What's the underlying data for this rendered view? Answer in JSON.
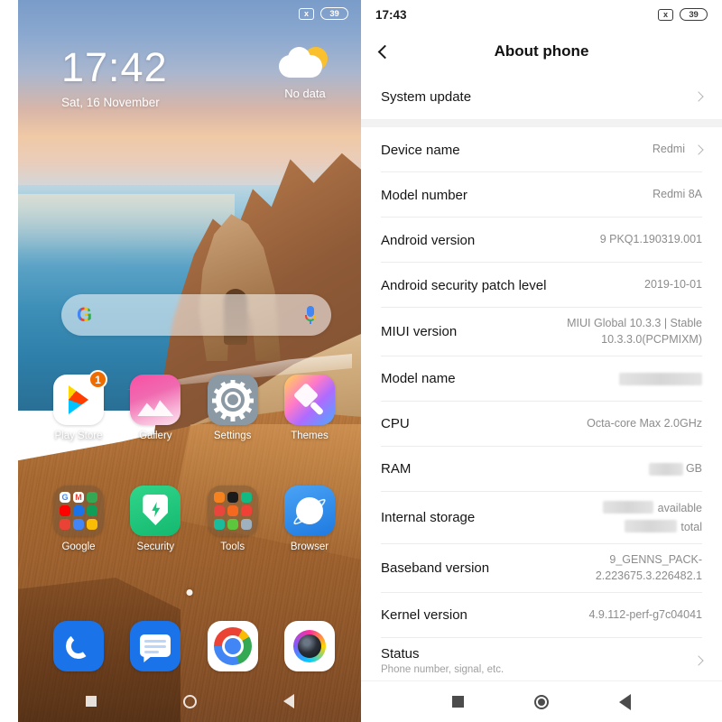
{
  "left_phone": {
    "status_bar": {
      "sim_icon": "no-sim-icon",
      "sim_glyph": "x",
      "battery": "39"
    },
    "lock": {
      "time": "17:42",
      "date": "Sat, 16 November",
      "weather_text": "No data",
      "weather_icon": "sun-behind-cloud-icon"
    },
    "search": {
      "logo": "G",
      "mic_icon": "microphone-icon"
    },
    "apps_row1": [
      {
        "label": "Play Store",
        "icon": "play-store-icon",
        "badge": "1"
      },
      {
        "label": "Gallery",
        "icon": "gallery-icon"
      },
      {
        "label": "Settings",
        "icon": "settings-gear-icon"
      },
      {
        "label": "Themes",
        "icon": "themes-brush-icon"
      }
    ],
    "apps_row2": [
      {
        "label": "Google",
        "icon": "google-folder-icon"
      },
      {
        "label": "Security",
        "icon": "security-shield-icon"
      },
      {
        "label": "Tools",
        "icon": "tools-folder-icon"
      },
      {
        "label": "Browser",
        "icon": "browser-planet-icon"
      }
    ],
    "dock": [
      {
        "label": "",
        "icon": "phone-icon"
      },
      {
        "label": "",
        "icon": "messages-icon"
      },
      {
        "label": "",
        "icon": "chrome-icon"
      },
      {
        "label": "",
        "icon": "camera-icon"
      }
    ],
    "nav": {
      "recents": "recents-square-icon",
      "home": "home-circle-icon",
      "back": "back-triangle-icon"
    }
  },
  "right_phone": {
    "status_bar": {
      "time": "17:43",
      "sim_glyph": "x",
      "battery": "39"
    },
    "appbar": {
      "back_icon": "back-chevron-icon",
      "title": "About phone"
    },
    "rows": [
      {
        "label": "System update",
        "value": "",
        "chevron": true
      },
      {
        "label": "Device name",
        "value": "Redmi",
        "chevron": true
      },
      {
        "label": "Model number",
        "value": "Redmi 8A",
        "chevron": false
      },
      {
        "label": "Android version",
        "value": "9 PKQ1.190319.001",
        "chevron": false
      },
      {
        "label": "Android security patch level",
        "value": "2019-10-01",
        "chevron": false
      },
      {
        "label": "MIUI version",
        "value": "MIUI Global 10.3.3 | Stable\n10.3.3.0(PCPMIXM)",
        "chevron": false
      },
      {
        "label": "Model name",
        "value": "",
        "redacted": true,
        "chevron": false
      },
      {
        "label": "CPU",
        "value": "Octa-core Max 2.0GHz",
        "chevron": false
      },
      {
        "label": "RAM",
        "value": "GB",
        "redacted": true,
        "chevron": false
      },
      {
        "label": "Internal storage",
        "value": "available\ntotal",
        "redacted": true,
        "chevron": false
      },
      {
        "label": "Baseband version",
        "value": "9_GENNS_PACK-\n2.223675.3.226482.1",
        "chevron": false
      },
      {
        "label": "Kernel version",
        "value": "4.9.112-perf-g7c04041",
        "chevron": false
      },
      {
        "label": "Status",
        "sublabel": "Phone number, signal, etc.",
        "value": "",
        "chevron": true
      }
    ],
    "labels": {
      "system_update": "System update",
      "device_name": "Device name",
      "device_name_value": "Redmi",
      "model_number": "Model number",
      "model_number_value": "Redmi 8A",
      "android_version": "Android version",
      "android_version_value": "9 PKQ1.190319.001",
      "security_patch": "Android security patch level",
      "security_patch_value": "2019-10-01",
      "miui_version": "MIUI version",
      "miui_version_value": "MIUI Global 10.3.3 | Stable\n10.3.3.0(PCPMIXM)",
      "model_name": "Model name",
      "cpu": "CPU",
      "cpu_value": "Octa-core Max 2.0GHz",
      "ram": "RAM",
      "ram_unit": "GB",
      "internal_storage": "Internal storage",
      "storage_available": "available",
      "storage_total": "total",
      "baseband": "Baseband version",
      "baseband_value": "9_GENNS_PACK-\n2.223675.3.226482.1",
      "kernel": "Kernel version",
      "kernel_value": "4.9.112-perf-g7c04041",
      "status": "Status",
      "status_sub": "Phone number, signal, etc."
    },
    "nav": {
      "recents": "recents-square-icon",
      "home": "home-circle-icon",
      "back": "back-triangle-icon"
    }
  },
  "colors": {
    "accent_blue": "#1a73e8",
    "text_primary": "#151515",
    "text_secondary": "#8c8c8c",
    "divider": "#ececec",
    "band": "#f2f2f2",
    "badge_orange": "#ef6c00"
  }
}
